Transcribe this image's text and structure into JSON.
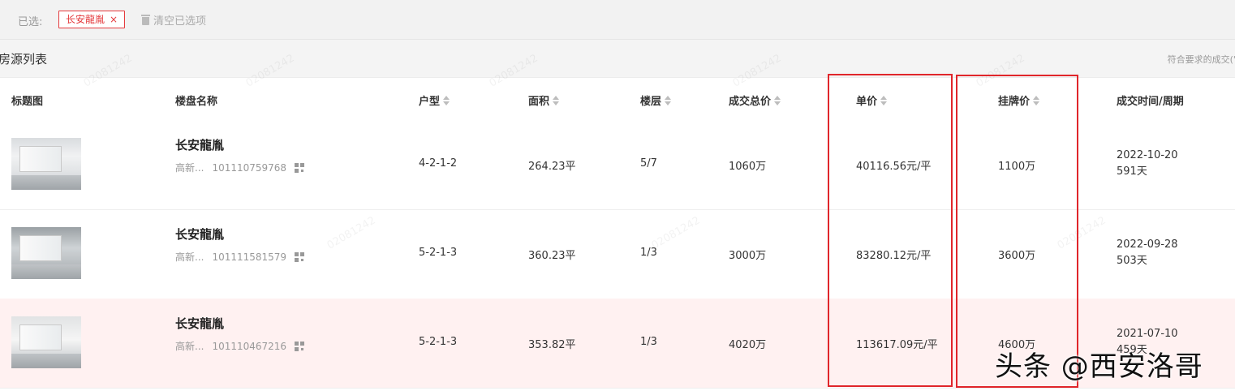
{
  "filter": {
    "label": "已选:",
    "chip_label": "长安龍胤",
    "chip_remove": "×",
    "clear_label": "清空已选项"
  },
  "section": {
    "title": "房源列表",
    "note": "符合要求的成交(\"'"
  },
  "columns": [
    {
      "label": "标题图",
      "sortable": false
    },
    {
      "label": "楼盘名称",
      "sortable": false
    },
    {
      "label": "户型",
      "sortable": true
    },
    {
      "label": "面积",
      "sortable": true
    },
    {
      "label": "楼层",
      "sortable": true
    },
    {
      "label": "成交总价",
      "sortable": true
    },
    {
      "label": "单价",
      "sortable": true
    },
    {
      "label": "挂牌价",
      "sortable": true
    },
    {
      "label": "成交时间/周期",
      "sortable": false
    }
  ],
  "rows": [
    {
      "name": "长安龍胤",
      "district": "高新...",
      "code": "101110759768",
      "layout": "4-2-1-2",
      "area": "264.23平",
      "floor": "5/7",
      "total": "1060万",
      "unit_price": "40116.56元/平",
      "listing_price": "1100万",
      "date": "2022-10-20",
      "period": "591天"
    },
    {
      "name": "长安龍胤",
      "district": "高新...",
      "code": "101111581579",
      "layout": "5-2-1-3",
      "area": "360.23平",
      "floor": "1/3",
      "total": "3000万",
      "unit_price": "83280.12元/平",
      "listing_price": "3600万",
      "date": "2022-09-28",
      "period": "503天"
    },
    {
      "name": "长安龍胤",
      "district": "高新...",
      "code": "101110467216",
      "layout": "5-2-1-3",
      "area": "353.82平",
      "floor": "1/3",
      "total": "4020万",
      "unit_price": "113617.09元/平",
      "listing_price": "4600万",
      "date": "2021-07-10",
      "period": "459天"
    }
  ],
  "watermark_text": "02081242",
  "brand_overlay": "头条 @西安洛哥",
  "colors": {
    "accent": "#e4393c",
    "highlight_row": "#fff1f1",
    "annotation": "#e0262b"
  }
}
